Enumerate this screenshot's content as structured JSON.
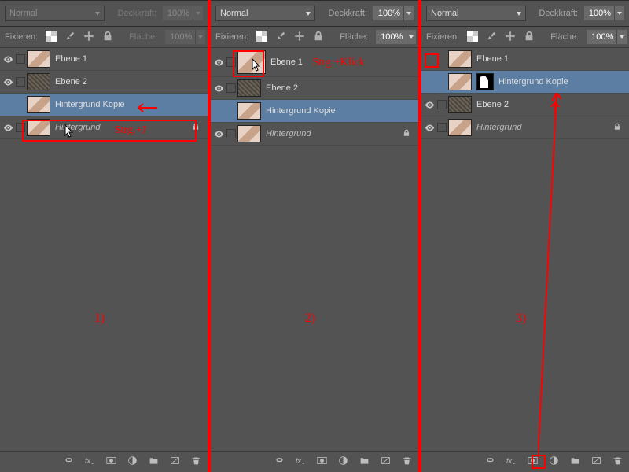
{
  "controls": {
    "blend_mode": "Normal",
    "opacity_label": "Deckkraft:",
    "opacity_value": "100%",
    "lock_label": "Fixieren:",
    "fill_label": "Fläche:",
    "fill_value": "100%"
  },
  "panels": [
    {
      "blend_enabled": false,
      "opacity_enabled": false,
      "fill_enabled": false,
      "layers": [
        {
          "name": "Ebene 1",
          "thumb": "face",
          "vis": true
        },
        {
          "name": "Ebene 2",
          "thumb": "tex",
          "vis": true
        },
        {
          "name": "Hintergrund Kopie",
          "thumb": "face",
          "vis": false,
          "sel": true
        },
        {
          "name": "Hintergrund",
          "thumb": "face",
          "vis": true,
          "italic": true,
          "lock": true
        }
      ]
    },
    {
      "blend_enabled": true,
      "opacity_enabled": true,
      "fill_enabled": true,
      "layers": [
        {
          "name": "Ebene 1",
          "thumb": "face",
          "vis": true,
          "bigthumb": true
        },
        {
          "name": "Ebene 2",
          "thumb": "tex",
          "vis": true
        },
        {
          "name": "Hintergrund Kopie",
          "thumb": "face",
          "vis": false,
          "sel": true
        },
        {
          "name": "Hintergrund",
          "thumb": "face",
          "vis": true,
          "italic": true,
          "lock": true
        }
      ]
    },
    {
      "blend_enabled": true,
      "opacity_enabled": true,
      "fill_enabled": true,
      "layers": [
        {
          "name": "Ebene 1",
          "thumb": "face",
          "vis": false
        },
        {
          "name": "Hintergrund Kopie",
          "thumb": "face",
          "vis": false,
          "sel": true,
          "mask": true
        },
        {
          "name": "Ebene 2",
          "thumb": "tex",
          "vis": true
        },
        {
          "name": "Hintergrund",
          "thumb": "face",
          "vis": true,
          "italic": true,
          "lock": true
        }
      ]
    }
  ],
  "footer_icons": [
    "link-icon",
    "fx-icon",
    "mask-icon",
    "adjust-icon",
    "group-icon",
    "new-icon",
    "trash-icon"
  ],
  "annotations": {
    "p1_arrow": true,
    "p1_text": "Strg.+J",
    "p2_text": "Strg.+Klick",
    "step1": "1)",
    "step2": "2)",
    "step3": "3)"
  }
}
